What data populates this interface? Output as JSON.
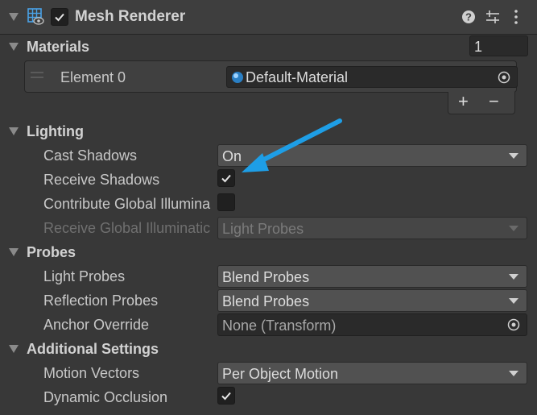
{
  "component": {
    "title": "Mesh Renderer",
    "enabled": true
  },
  "materials": {
    "label": "Materials",
    "count": "1",
    "element_label": "Element 0",
    "element_value": "Default-Material",
    "add": "+",
    "remove": "−"
  },
  "lighting": {
    "label": "Lighting",
    "cast_shadows_label": "Cast Shadows",
    "cast_shadows_value": "On",
    "receive_shadows_label": "Receive Shadows",
    "receive_shadows": true,
    "contribute_gi_label": "Contribute Global Illumina",
    "contribute_gi": false,
    "receive_gi_label": "Receive Global Illuminatic",
    "receive_gi_value": "Light Probes"
  },
  "probes": {
    "label": "Probes",
    "light_probes_label": "Light Probes",
    "light_probes_value": "Blend Probes",
    "reflection_probes_label": "Reflection Probes",
    "reflection_probes_value": "Blend Probes",
    "anchor_override_label": "Anchor Override",
    "anchor_override_value": "None (Transform)"
  },
  "additional": {
    "label": "Additional Settings",
    "motion_vectors_label": "Motion Vectors",
    "motion_vectors_value": "Per Object Motion",
    "dynamic_occlusion_label": "Dynamic Occlusion",
    "dynamic_occlusion": true
  },
  "colors": {
    "arrow": "#1e9ee6",
    "background": "#383838",
    "field": "#515151"
  }
}
